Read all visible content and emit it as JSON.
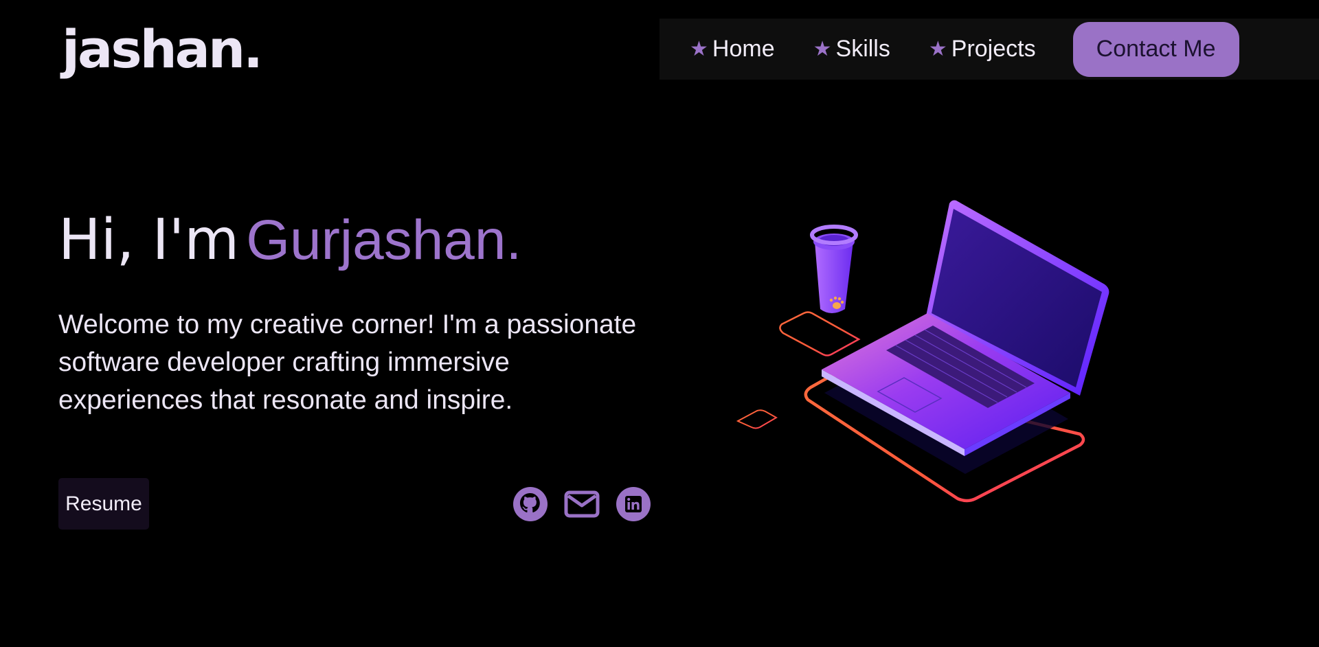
{
  "header": {
    "logo": "jashan."
  },
  "nav": {
    "items": [
      {
        "label": "Home",
        "icon": "star-icon"
      },
      {
        "label": "Skills",
        "icon": "star-icon"
      },
      {
        "label": "Projects",
        "icon": "star-icon"
      }
    ],
    "star_glyph": "★",
    "contact_label": "Contact Me"
  },
  "hero": {
    "greeting": "Hi, I'm",
    "name": "Gurjashan.",
    "description": "Welcome to my creative corner! I'm a passionate software developer crafting immersive experiences that resonate and inspire.",
    "resume_label": "Resume"
  },
  "socials": [
    {
      "icon": "github-icon"
    },
    {
      "icon": "mail-icon"
    },
    {
      "icon": "linkedin-icon"
    }
  ],
  "illustration": {
    "icon": "laptop-coffee-illustration"
  },
  "colors": {
    "background": "#000000",
    "accent": "#9a72c6",
    "text": "#ece6f5",
    "navbar": "#0e0e0e",
    "resume_bg": "#140c1d"
  }
}
